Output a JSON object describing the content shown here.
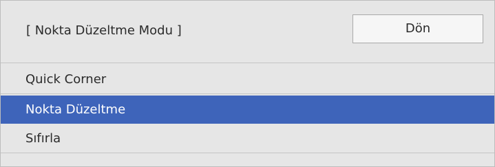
{
  "header": {
    "title": "[ Nokta Düzeltme Modu ]",
    "back_label": "Dön"
  },
  "menu": {
    "items": [
      {
        "label": "Quick Corner",
        "selected": false
      },
      {
        "label": "Nokta Düzeltme",
        "selected": true
      },
      {
        "label": "Sıfırla",
        "selected": false
      }
    ]
  },
  "colors": {
    "panel_background": "#e6e6e6",
    "selected_background": "#3e64ba",
    "selected_text": "#ffffff",
    "text": "#2b2b2b"
  }
}
